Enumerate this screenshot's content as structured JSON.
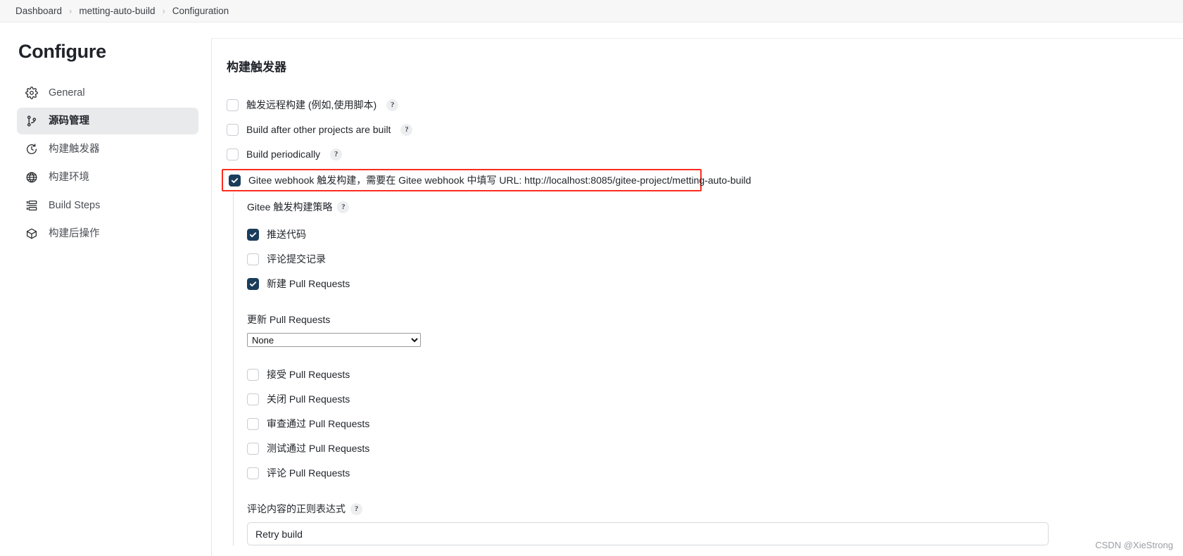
{
  "breadcrumb": {
    "separator": "›",
    "items": [
      {
        "label": "Dashboard"
      },
      {
        "label": "metting-auto-build"
      },
      {
        "label": "Configuration"
      }
    ]
  },
  "sidebar": {
    "title": "Configure",
    "items": [
      {
        "label": "General",
        "icon": "gear-icon",
        "active": false
      },
      {
        "label": "源码管理",
        "icon": "branch-icon",
        "active": true
      },
      {
        "label": "构建触发器",
        "icon": "clock-icon",
        "active": false
      },
      {
        "label": "构建环境",
        "icon": "globe-icon",
        "active": false
      },
      {
        "label": "Build Steps",
        "icon": "list-icon",
        "active": false
      },
      {
        "label": "构建后操作",
        "icon": "package-icon",
        "active": false
      }
    ]
  },
  "main": {
    "section_title": "构建触发器",
    "help_glyph": "?",
    "triggers": [
      {
        "label": "触发远程构建 (例如,使用脚本)",
        "checked": false,
        "help": true
      },
      {
        "label": "Build after other projects are built",
        "checked": false,
        "help": true
      },
      {
        "label": "Build periodically",
        "checked": false,
        "help": true
      }
    ],
    "webhook": {
      "label": "Gitee webhook 触发构建，需要在 Gitee webhook 中填写 URL: http://localhost:8085/gitee-project/metting-auto-build",
      "checked": true,
      "highlight_color": "#fb2c1e"
    },
    "strategy": {
      "heading": "Gitee 触发构建策略",
      "help": true,
      "options": [
        {
          "label": "推送代码",
          "checked": true
        },
        {
          "label": "评论提交记录",
          "checked": false
        },
        {
          "label": "新建 Pull Requests",
          "checked": true
        }
      ],
      "update_pr_label": "更新 Pull Requests",
      "update_pr_value": "None",
      "update_pr_options": [
        "None"
      ],
      "pr_options": [
        {
          "label": "接受 Pull Requests",
          "checked": false
        },
        {
          "label": "关闭 Pull Requests",
          "checked": false
        },
        {
          "label": "审查通过 Pull Requests",
          "checked": false
        },
        {
          "label": "测试通过 Pull Requests",
          "checked": false
        },
        {
          "label": "评论 Pull Requests",
          "checked": false
        }
      ],
      "regex_label": "评论内容的正则表达式",
      "regex_help": true,
      "regex_value": "Retry build"
    }
  },
  "watermark": "CSDN @XieStrong"
}
